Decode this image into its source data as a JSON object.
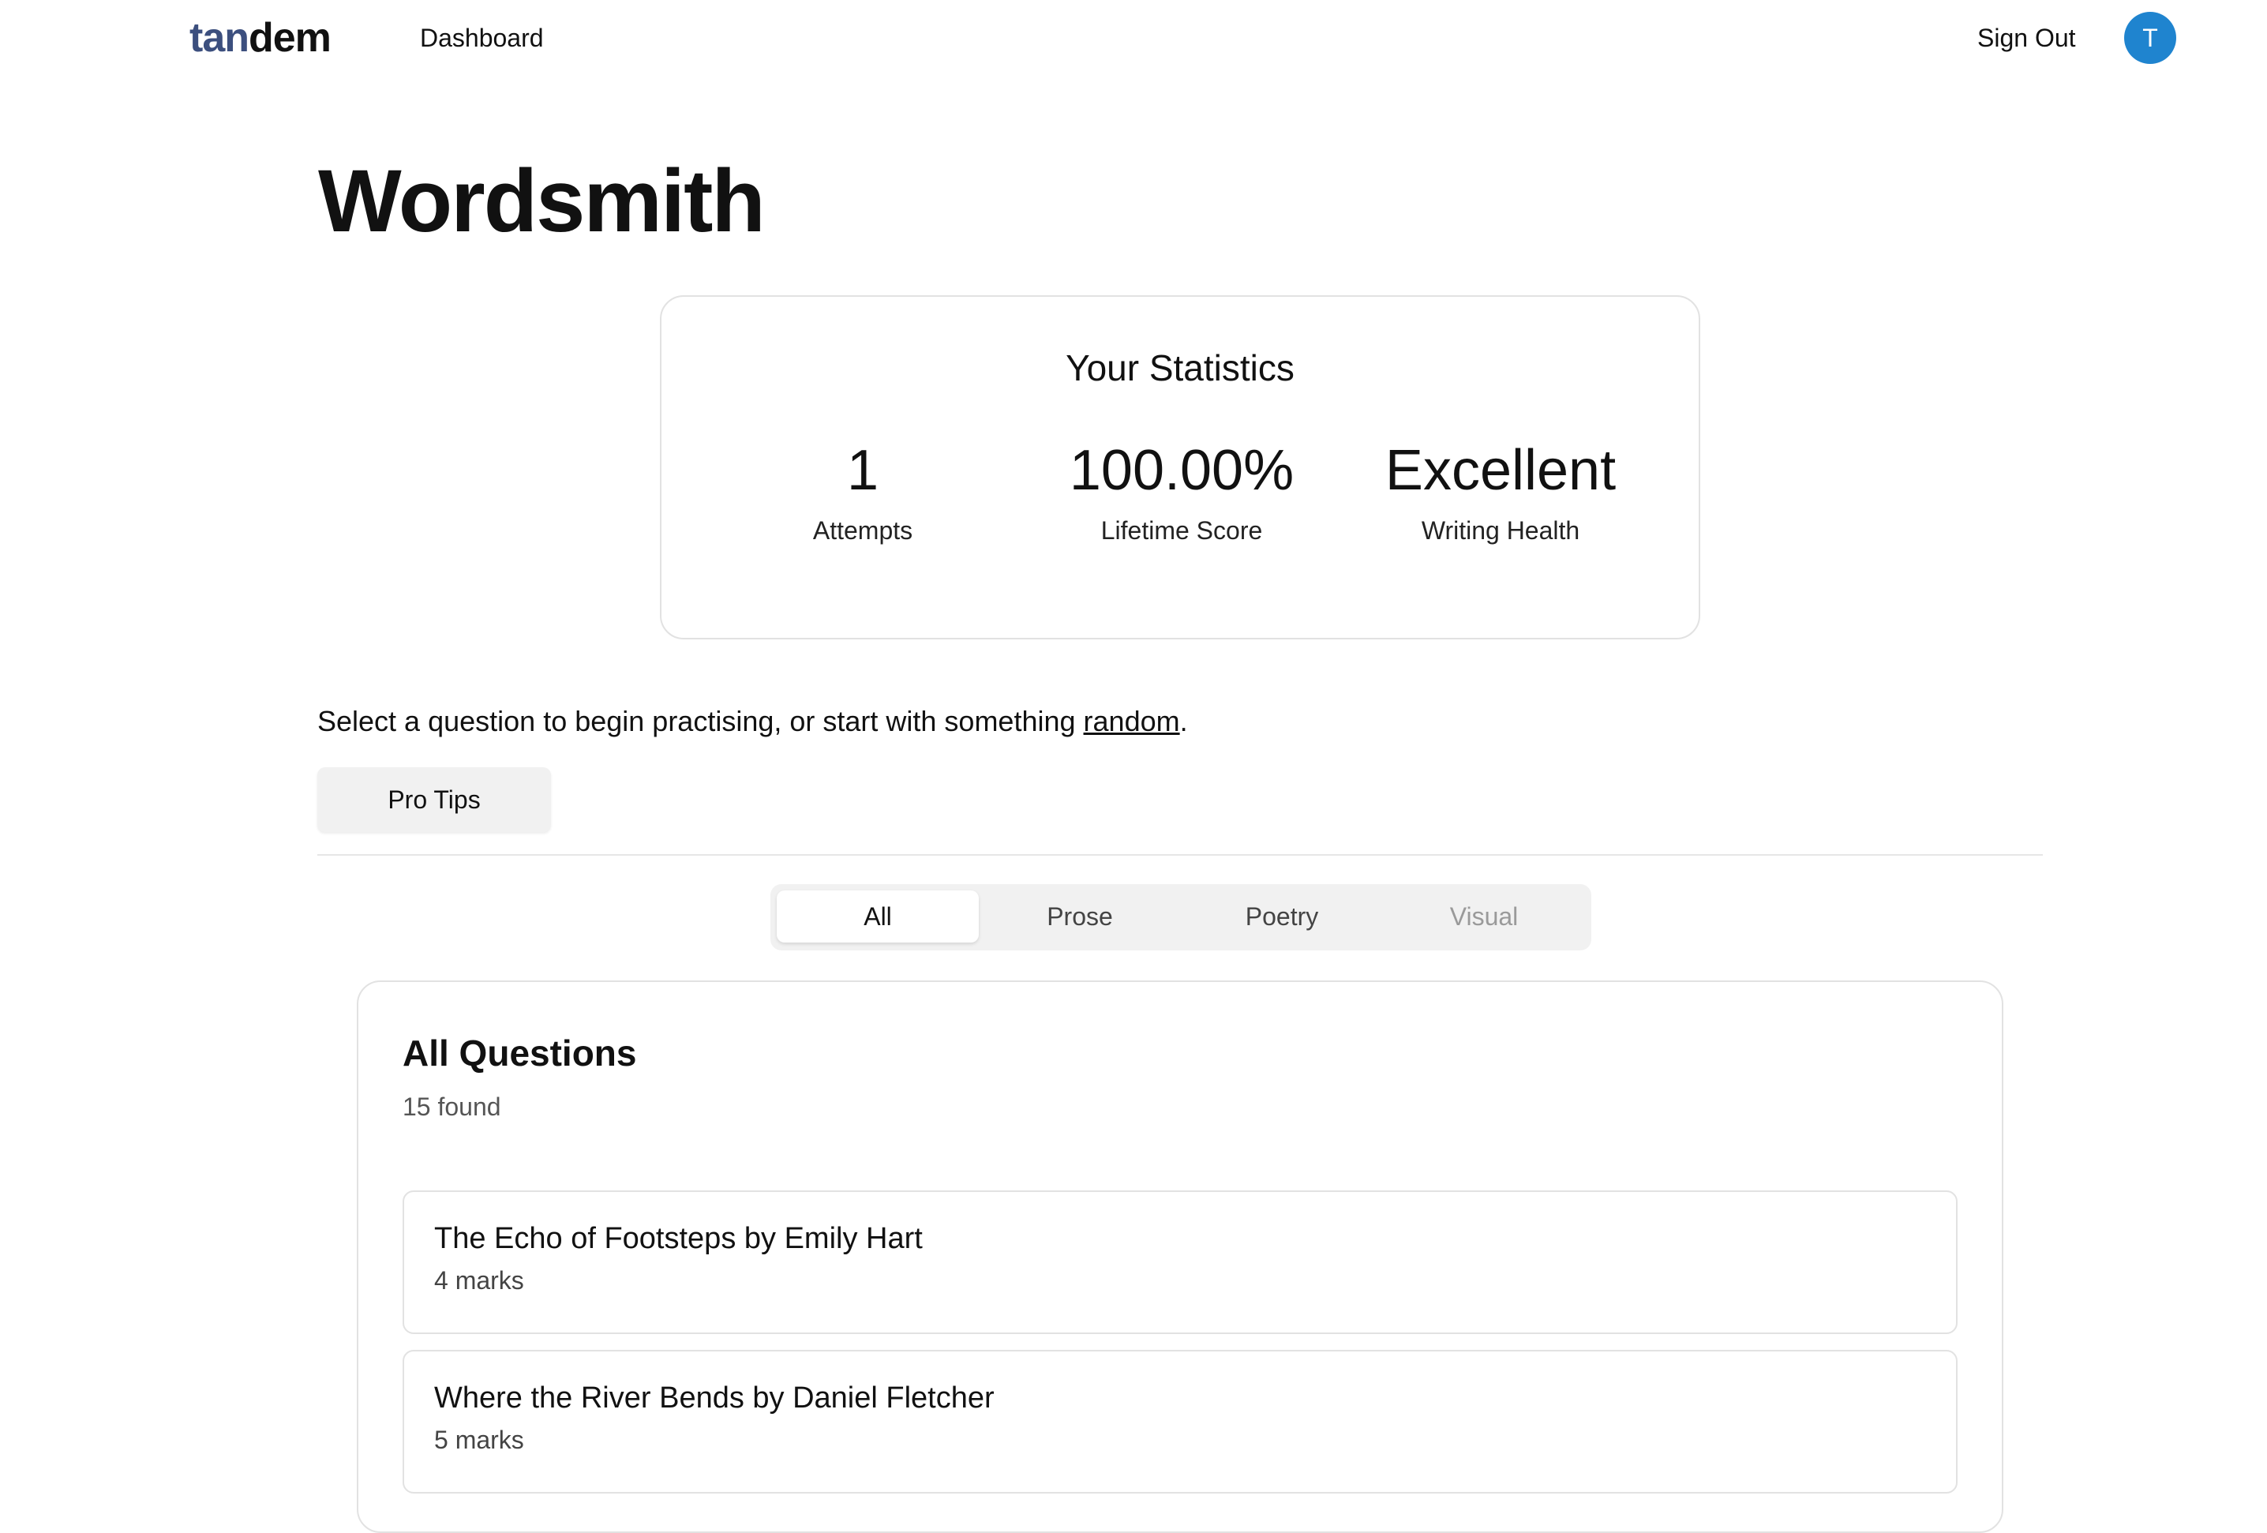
{
  "nav": {
    "logo_part1": "tan",
    "logo_part2": "dem",
    "dashboard_label": "Dashboard",
    "signout_label": "Sign Out",
    "avatar_initial": "T"
  },
  "page": {
    "title": "Wordsmith"
  },
  "stats": {
    "title": "Your Statistics",
    "items": [
      {
        "value": "1",
        "label": "Attempts"
      },
      {
        "value": "100.00%",
        "label": "Lifetime Score"
      },
      {
        "value": "Excellent",
        "label": "Writing Health"
      }
    ]
  },
  "instructions": {
    "text_before": "Select a question to begin practising, or start with something ",
    "link_label": "random",
    "text_after": "."
  },
  "pro_tips_label": "Pro Tips",
  "tabs": [
    {
      "label": "All",
      "active": true
    },
    {
      "label": "Prose",
      "active": false
    },
    {
      "label": "Poetry",
      "active": false
    },
    {
      "label": "Visual",
      "active": false
    }
  ],
  "questions": {
    "title": "All Questions",
    "count_text": "15 found",
    "items": [
      {
        "title": "The Echo of Footsteps by Emily Hart",
        "marks": "4 marks"
      },
      {
        "title": "Where the River Bends by Daniel Fletcher",
        "marks": "5 marks"
      }
    ]
  },
  "colors": {
    "logo_accent": "#3c4f7e",
    "avatar_bg": "#1f84cf"
  }
}
